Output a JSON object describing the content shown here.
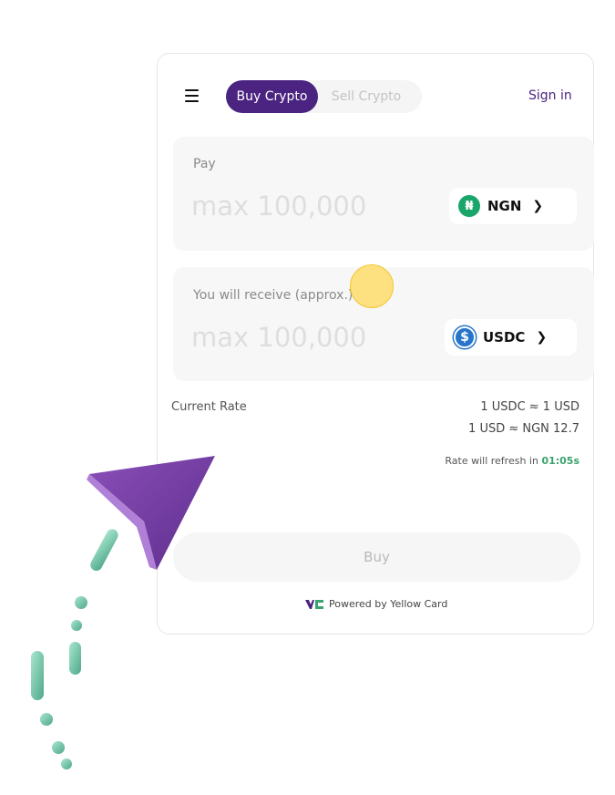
{
  "header": {
    "tabs": [
      {
        "label": "Buy Crypto",
        "active": true
      },
      {
        "label": "Sell Crypto",
        "active": false
      }
    ],
    "signin_label": "Sign in"
  },
  "pay": {
    "label": "Pay",
    "placeholder": "max 100,000",
    "currency": {
      "code": "NGN",
      "icon": "naira-icon",
      "color": "#1aa56a"
    }
  },
  "receive": {
    "label": "You will receive (approx.)",
    "placeholder": "max 100,000",
    "currency": {
      "code": "USDC",
      "icon": "usdc-icon",
      "color": "#2775ca"
    }
  },
  "rate": {
    "label": "Current Rate",
    "line1": "1 USDC ≈ 1 USD",
    "line2": "1 USD ≈ NGN 12.7",
    "refresh_text": "Rate will refresh in",
    "timer": "01:05s"
  },
  "buy_label": "Buy",
  "footer": {
    "powered_text": "Powered by Yellow Card"
  },
  "colors": {
    "brand_purple": "#4a2480",
    "timer_green": "#3aa36f",
    "cursor_yellow": "#f3c531"
  }
}
